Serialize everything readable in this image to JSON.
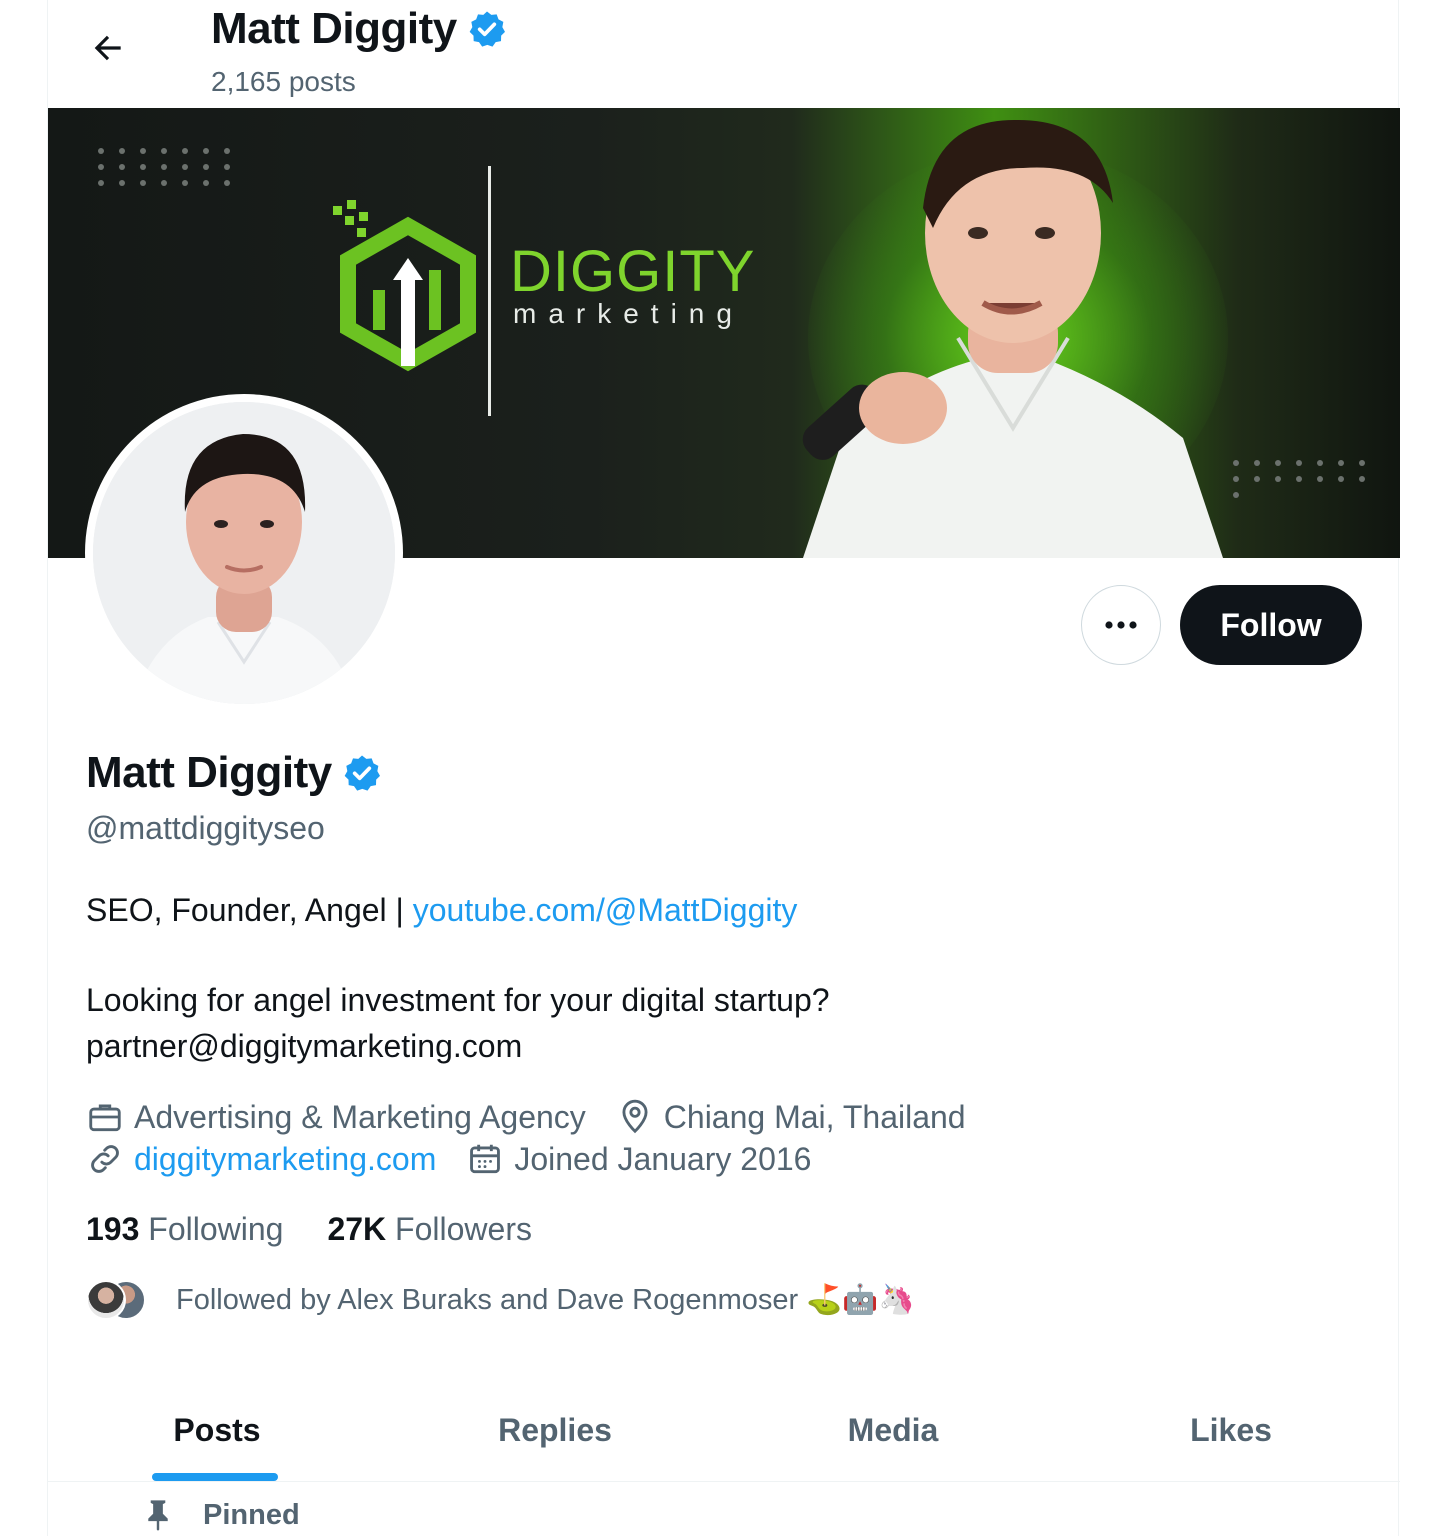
{
  "header": {
    "name": "Matt Diggity",
    "posts_count": "2,165 posts"
  },
  "banner": {
    "logo_word": "DIGGITY",
    "logo_sub": "marketing"
  },
  "actions": {
    "follow_label": "Follow"
  },
  "profile": {
    "name": "Matt Diggity",
    "handle": "@mattdiggityseo",
    "bio_prefix": "SEO, Founder, Angel | ",
    "bio_link": "youtube.com/@MattDiggity",
    "bio_line2": "Looking for angel investment for your digital startup?",
    "bio_line3": "partner@diggitymarketing.com"
  },
  "meta": {
    "category": "Advertising & Marketing Agency",
    "location": "Chiang Mai, Thailand",
    "website": "diggitymarketing.com",
    "joined": "Joined January 2016"
  },
  "stats": {
    "following_count": "193",
    "following_label": "Following",
    "followers_count": "27K",
    "followers_label": "Followers"
  },
  "followed_by": {
    "text": "Followed by Alex Buraks and Dave Rogenmoser ⛳🤖🦄"
  },
  "tabs": [
    {
      "label": "Posts"
    },
    {
      "label": "Replies"
    },
    {
      "label": "Media"
    },
    {
      "label": "Likes"
    }
  ],
  "pinned_label": "Pinned",
  "colors": {
    "accent": "#1d9bf0",
    "text_primary": "#0f1419",
    "text_secondary": "#536471",
    "banner_green": "#7fd42d"
  },
  "icons": [
    "back-arrow-icon",
    "verified-badge-icon",
    "more-icon",
    "briefcase-icon",
    "location-pin-icon",
    "link-icon",
    "calendar-icon",
    "pin-icon"
  ]
}
